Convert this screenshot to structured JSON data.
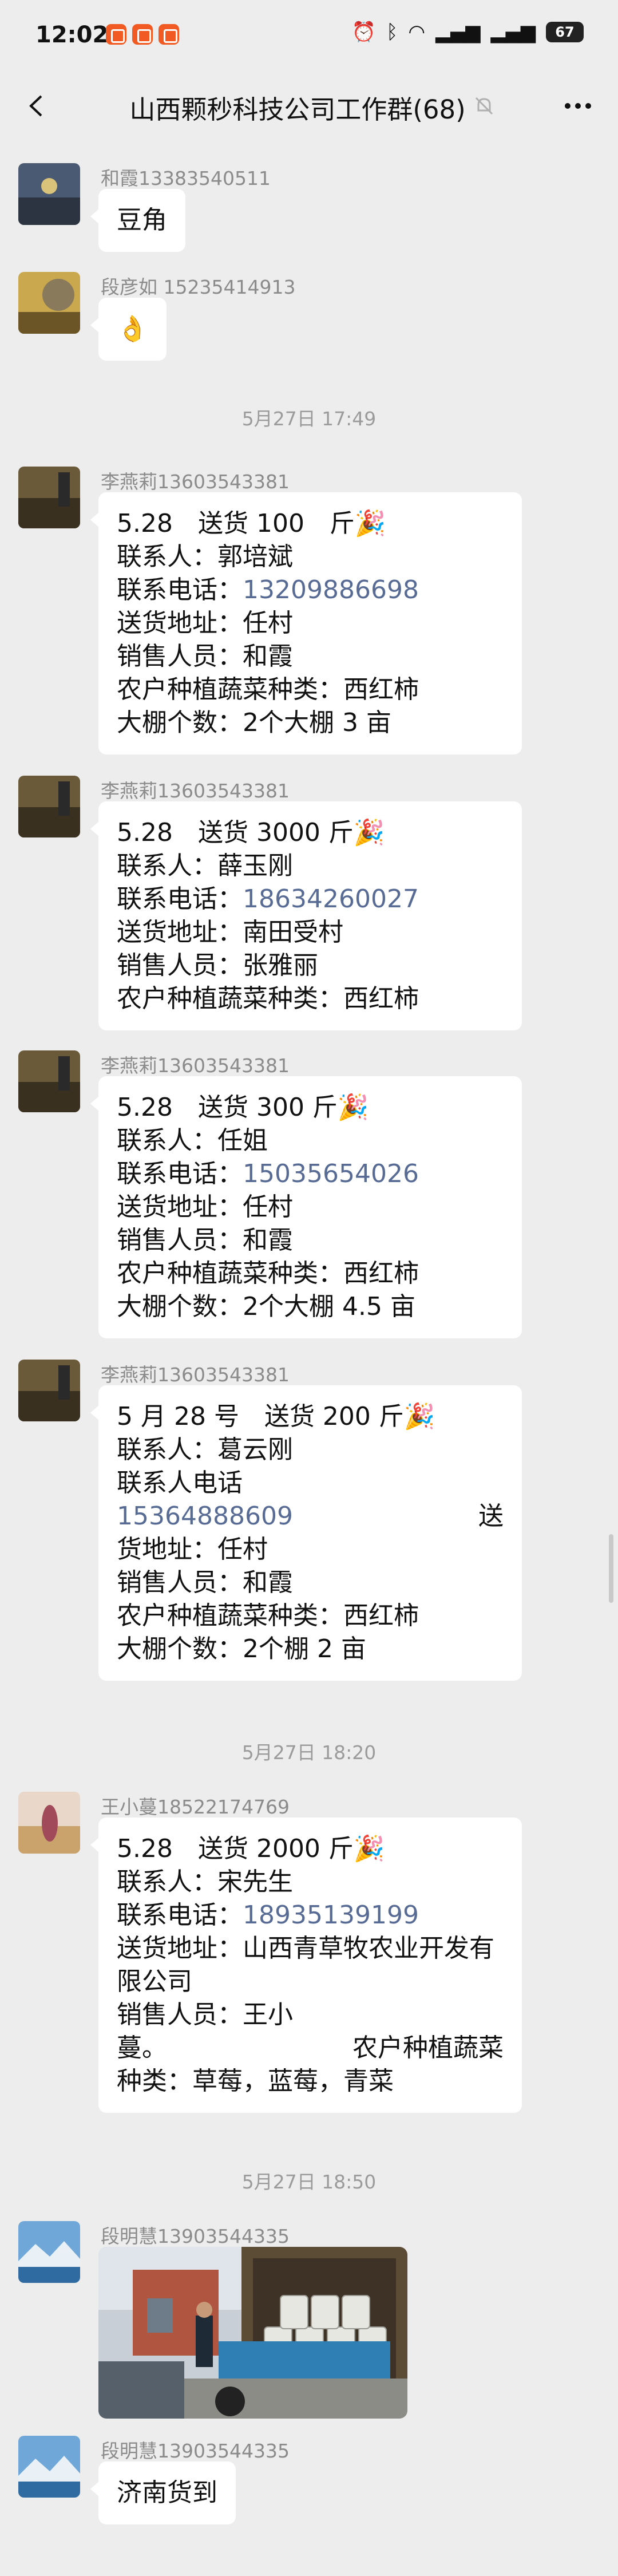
{
  "status_bar": {
    "time": "12:02",
    "battery": "67"
  },
  "chat": {
    "title": "山西颗秒科技公司工作群(68)"
  },
  "messages": [
    {
      "sender": "和霞13383540511",
      "text": "豆角"
    },
    {
      "sender": "段彦如 15235414913",
      "text": "👌"
    },
    {
      "divider": "5月27日 17:49"
    },
    {
      "sender": "李燕莉13603543381",
      "lines": [
        "5.28　送货 100　斤🎉",
        "联系人：郭培斌",
        "联系电话：",
        "送货地址：任村",
        "销售人员：和霞",
        "农户种植蔬菜种类：西红柿",
        "大棚个数：2个大棚 3 亩"
      ],
      "phone": "13209886698"
    },
    {
      "sender": "李燕莉13603543381",
      "lines": [
        "5.28　送货 3000 斤🎉",
        "联系人：薛玉刚",
        "联系电话：",
        "送货地址：南田受村",
        "销售人员：张雅丽",
        "农户种植蔬菜种类：西红柿"
      ],
      "phone": "18634260027"
    },
    {
      "sender": "李燕莉13603543381",
      "lines": [
        "5.28　送货 300 斤🎉",
        "联系人：任姐",
        "联系电话：",
        "送货地址：任村",
        "销售人员：和霞",
        "农户种植蔬菜种类：西红柿",
        "大棚个数：2个大棚 4.5 亩"
      ],
      "phone": "15035654026"
    },
    {
      "sender": "李燕莉13603543381",
      "lines": [
        "5 月 28 号　送货 200 斤🎉",
        "联系人：葛云刚",
        "联系人电话",
        "送",
        "货地址：任村",
        "销售人员：和霞",
        "农户种植蔬菜种类：西红柿",
        "大棚个数：2个棚 2 亩"
      ],
      "phone": "15364888609"
    },
    {
      "divider": "5月27日 18:20"
    },
    {
      "sender": "王小蔓18522174769",
      "lines": [
        "5.28　送货 2000 斤🎉",
        "联系人：宋先生",
        "联系电话：",
        "送货地址：山西青草牧农业开发有",
        "限公司",
        "销售人员：王小",
        "蔓。",
        "农户种植蔬菜",
        "种类：草莓，蓝莓，青菜"
      ],
      "phone": "18935139199"
    },
    {
      "divider": "5月27日 18:50"
    },
    {
      "sender": "段明慧13903544335",
      "image": "delivery-photo"
    },
    {
      "sender": "段明慧13903544335",
      "text": "济南货到"
    }
  ]
}
